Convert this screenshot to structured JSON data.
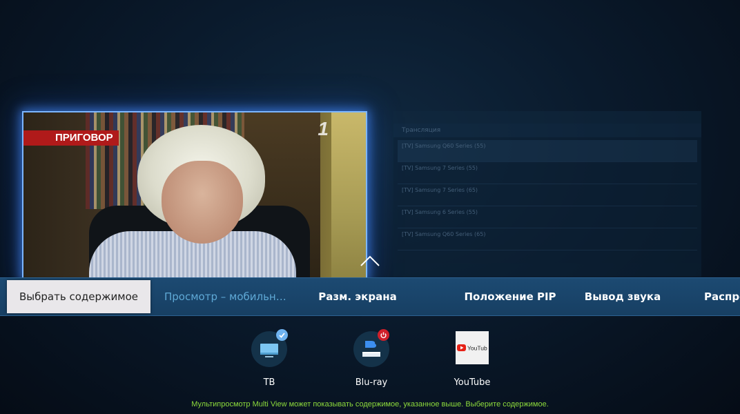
{
  "tv_view": {
    "program_title": "ПРИГОВОР",
    "channel_logo": "1"
  },
  "mirror_view": {
    "heading": "Трансляция",
    "rows": [
      "[TV] Samsung Q60 Series (55)",
      "[TV] Samsung 7 Series (55)",
      "[TV] Samsung 7 Series (65)",
      "[TV] Samsung 6 Series (55)",
      "[TV] Samsung Q60 Series (65)"
    ]
  },
  "menu": {
    "items": [
      "Выбрать содержимое",
      "Просмотр – мобильн…",
      "Разм. экрана",
      "Положение PIP",
      "Вывод звука",
      "Распред"
    ]
  },
  "sources": [
    {
      "label": "ТВ",
      "icon": "tv-icon",
      "badge": "check-badge-icon",
      "badge_color": "#6fb3f0"
    },
    {
      "label": "Blu-ray",
      "icon": "bluray-player-icon",
      "badge": "power-badge-icon",
      "badge_color": "#d0202a"
    },
    {
      "label": "YouTube",
      "icon": "youtube-logo-icon"
    }
  ],
  "hint": "Мультипросмотр Multi View может показывать содержимое, указанное выше. Выберите содержимое.",
  "colors": {
    "focus_glow": "#7cb6ff",
    "menu_bar": "#1c4a72",
    "hint_text": "#8edc3c",
    "youtube_red": "#e62117"
  }
}
